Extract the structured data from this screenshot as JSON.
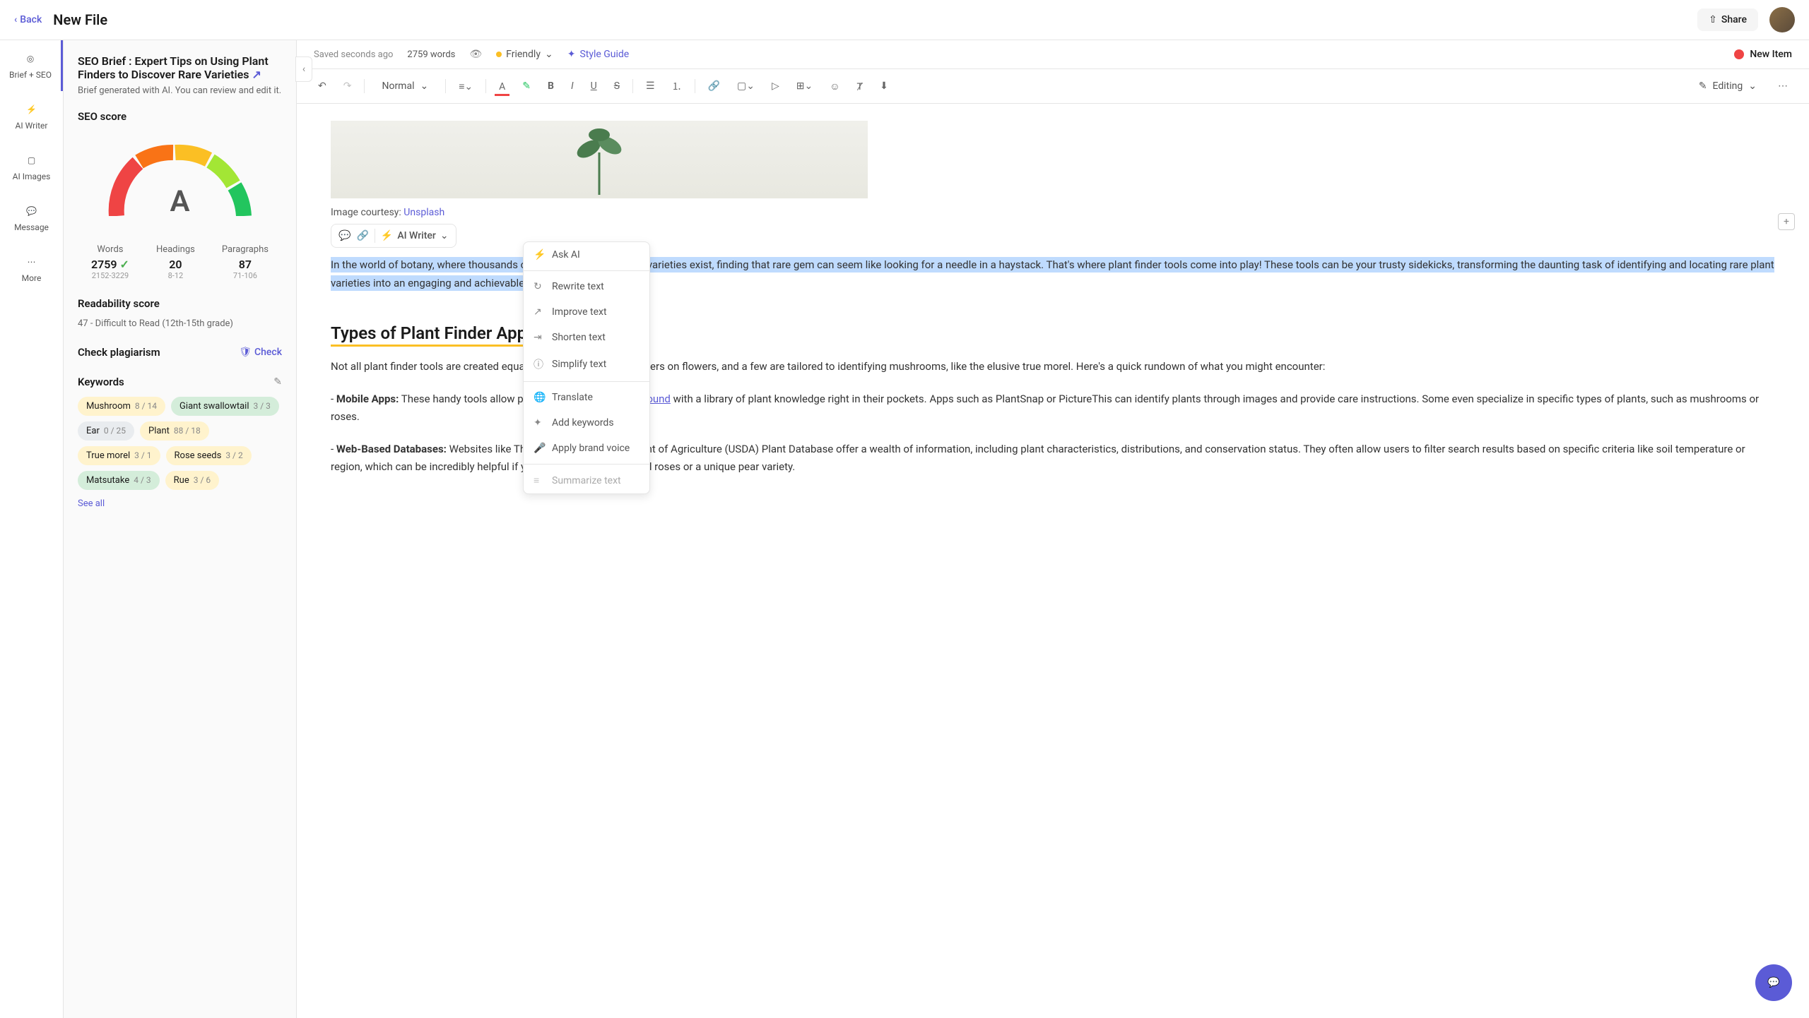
{
  "topbar": {
    "back": "Back",
    "title": "New File",
    "share": "Share"
  },
  "leftbar": {
    "items": [
      {
        "label": "Brief + SEO"
      },
      {
        "label": "AI Writer"
      },
      {
        "label": "AI Images"
      },
      {
        "label": "Message"
      },
      {
        "label": "More"
      }
    ]
  },
  "brief": {
    "title": "SEO Brief : Expert Tips on Using Plant Finders to Discover Rare Varieties",
    "desc": "Brief generated with AI. You can review and edit it."
  },
  "seo": {
    "title": "SEO score",
    "grade": "A"
  },
  "stats": {
    "words": {
      "label": "Words",
      "val": "2759",
      "range": "2152-3229"
    },
    "headings": {
      "label": "Headings",
      "val": "20",
      "range": "8-12"
    },
    "paragraphs": {
      "label": "Paragraphs",
      "val": "87",
      "range": "71-106"
    }
  },
  "readability": {
    "title": "Readability score",
    "text": "47 - Difficult to Read (12th-15th grade)"
  },
  "plagiarism": {
    "title": "Check plagiarism",
    "check": "Check"
  },
  "keywords": {
    "title": "Keywords",
    "seeAll": "See all",
    "items": [
      {
        "name": "Mushroom",
        "count": "8 / 14",
        "cls": "kw-yellow"
      },
      {
        "name": "Giant swallowtail",
        "count": "3 / 3",
        "cls": "kw-green"
      },
      {
        "name": "Ear",
        "count": "0 / 25",
        "cls": "kw-gray"
      },
      {
        "name": "Plant",
        "count": "88 / 18",
        "cls": "kw-yellow"
      },
      {
        "name": "True morel",
        "count": "3 / 1",
        "cls": "kw-yellow"
      },
      {
        "name": "Rose seeds",
        "count": "3 / 2",
        "cls": "kw-yellow"
      },
      {
        "name": "Matsutake",
        "count": "4 / 3",
        "cls": "kw-green"
      },
      {
        "name": "Rue",
        "count": "3 / 6",
        "cls": "kw-yellow"
      }
    ]
  },
  "header": {
    "saved": "Saved seconds ago",
    "words": "2759 words",
    "friendly": "Friendly",
    "styleGuide": "Style Guide",
    "newItem": "New Item"
  },
  "toolbar": {
    "normal": "Normal",
    "editing": "Editing"
  },
  "editor": {
    "caption": "Image courtesy: ",
    "captionLink": "Unsplash",
    "aiWriter": "AI Writer",
    "p1": "In the world of botany, where thousands of fascinating species and varieties exist, finding that rare gem can seem like looking for a needle in a haystack. That's where plant finder tools come into play! These tools can be your trusty sidekicks, transforming the daunting task of identifying and locating rare plant varieties into an engaging and achievable endeavor.",
    "h2": "Types of Plant Finder Applications",
    "p2": "Not all plant finder tools are created equal. Some focus on trees, others on flowers, and a few are tailored to identifying mushrooms, like the elusive true morel. Here's a quick rundown of what you might encounter:",
    "p3a": "- ",
    "p3bold": "Mobile Apps:",
    "p3b": " These handy tools allow plant enthusiasts to walk ",
    "p3link": "around",
    "p3c": " with a library of plant knowledge right in their pockets. Apps such as PlantSnap or PictureThis can identify plants through images and provide care instructions. Some even specialize in specific types of plants, such as mushrooms or roses.",
    "p4a": "- ",
    "p4bold": "Web-Based Databases:",
    "p4b": " Websites like The United States Department of Agriculture (USDA) Plant Database offer a wealth of information, including plant characteristics, distributions, and conservation status. They often allow users to filter search results based on specific criteria like soil temperature or region, which can be incredibly helpful if you're on the hunt for hybrid roses or a unique pear variety."
  },
  "dropdown": {
    "items": [
      "Ask AI",
      "Rewrite text",
      "Improve text",
      "Shorten text",
      "Simplify text",
      "Translate",
      "Add keywords",
      "Apply brand voice",
      "Summarize text"
    ]
  }
}
